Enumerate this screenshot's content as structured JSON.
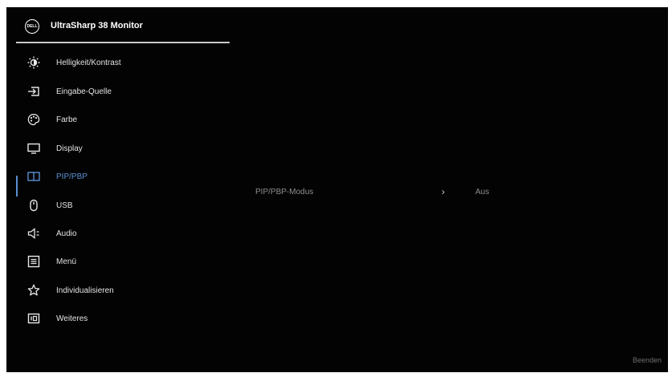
{
  "header": {
    "logo_text": "DELL",
    "title": "UltraSharp 38 Monitor"
  },
  "colors": {
    "background": "#030303",
    "accent": "#5a8fd0",
    "text": "#e3e3e3",
    "muted": "#8e8e8e"
  },
  "sidebar": {
    "items": [
      {
        "label": "Helligkeit/Kontrast",
        "icon": "brightness-icon"
      },
      {
        "label": "Eingabe-Quelle",
        "icon": "input-source-icon"
      },
      {
        "label": "Farbe",
        "icon": "color-palette-icon"
      },
      {
        "label": "Display",
        "icon": "display-icon"
      },
      {
        "label": "PIP/PBP",
        "icon": "pip-pbp-icon",
        "active": true
      },
      {
        "label": "USB",
        "icon": "usb-mouse-icon"
      },
      {
        "label": "Audio",
        "icon": "speaker-icon"
      },
      {
        "label": "Menü",
        "icon": "menu-icon"
      },
      {
        "label": "Individualisieren",
        "icon": "star-icon"
      },
      {
        "label": "Weiteres",
        "icon": "others-icon"
      }
    ]
  },
  "main": {
    "setting": {
      "label": "PIP/PBP-Modus",
      "value": "Aus"
    }
  },
  "footer": {
    "exit_label": "Beenden"
  }
}
